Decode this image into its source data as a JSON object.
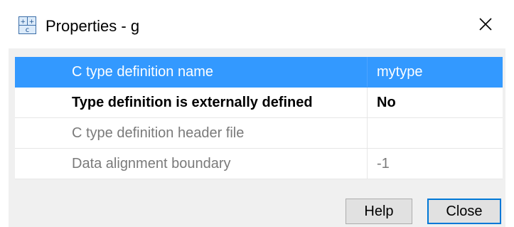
{
  "window": {
    "title": "Properties - g",
    "icon": "type-definition-icon",
    "close_icon": "close-icon"
  },
  "properties": [
    {
      "name": "C type definition name",
      "value": "mytype",
      "state": "selected"
    },
    {
      "name": "Type definition is externally defined",
      "value": "No",
      "state": "active"
    },
    {
      "name": "C type definition header file",
      "value": "",
      "state": "disabled"
    },
    {
      "name": "Data alignment boundary",
      "value": "-1",
      "state": "disabled"
    }
  ],
  "buttons": {
    "help_label": "Help",
    "close_label": "Close"
  },
  "colors": {
    "selection": "#3399ff",
    "dialog_background": "#f0f0f0",
    "disabled_text": "#7a7a7a",
    "focus_border": "#0078d7"
  }
}
